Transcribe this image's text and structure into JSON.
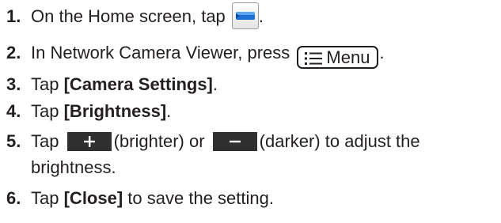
{
  "steps": [
    {
      "number": "1.",
      "before": "On the Home screen, tap",
      "icon": "network-camera-app-icon",
      "after": "."
    },
    {
      "number": "2.",
      "before": "In Network Camera Viewer, press",
      "key_label": "Menu",
      "key_icon": "menu-list-icon",
      "after": "."
    },
    {
      "number": "3.",
      "before": "Tap",
      "keyword": "[Camera Settings]",
      "after": "."
    },
    {
      "number": "4.",
      "before": "Tap",
      "keyword": "[Brightness]",
      "after": "."
    },
    {
      "number": "5.",
      "before": "Tap",
      "plus_icon": "plus-icon",
      "middle": "(brighter) or",
      "minus_icon": "minus-icon",
      "after": "(darker) to adjust the",
      "continuation": "brightness."
    },
    {
      "number": "6.",
      "before": "Tap",
      "keyword": "[Close]",
      "after": "to save the setting."
    }
  ],
  "colors": {
    "text": "#231f20",
    "button_bg": "#2f2f2f",
    "icon_blue": "#1d6fd1"
  }
}
